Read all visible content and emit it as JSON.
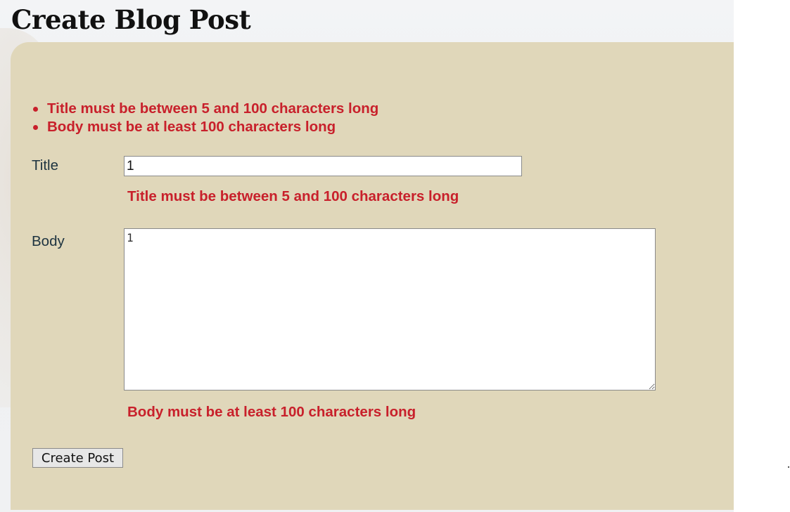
{
  "page": {
    "title": "Create Blog Post"
  },
  "validation_summary": {
    "errors": [
      "Title must be between 5 and 100 characters long",
      "Body must be at least 100 characters long"
    ]
  },
  "form": {
    "title_field": {
      "label": "Title",
      "value": "1",
      "error": "Title must be between 5 and 100 characters long"
    },
    "body_field": {
      "label": "Body",
      "value": "1",
      "error": "Body must be at least 100 characters long"
    },
    "submit_label": "Create Post"
  },
  "colors": {
    "panel_background": "#e0d7ba",
    "error_text": "#c8202b",
    "label_text": "#1d3340"
  }
}
